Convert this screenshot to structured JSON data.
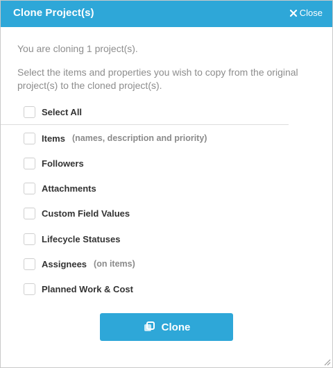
{
  "dialog": {
    "title": "Clone Project(s)",
    "close_label": "Close",
    "accent_color": "#2ea7d8"
  },
  "info": {
    "line1": "You are cloning 1 project(s).",
    "line2": "Select the items and properties you wish to copy from the original project(s) to the cloned project(s)."
  },
  "options": {
    "select_all": {
      "label": "Select All",
      "checked": false
    },
    "items": [
      {
        "label": "Items",
        "note": "(names, description and priority)",
        "checked": false
      },
      {
        "label": "Followers",
        "note": "",
        "checked": false
      },
      {
        "label": "Attachments",
        "note": "",
        "checked": false
      },
      {
        "label": "Custom Field Values",
        "note": "",
        "checked": false
      },
      {
        "label": "Lifecycle Statuses",
        "note": "",
        "checked": false
      },
      {
        "label": "Assignees",
        "note": "(on items)",
        "checked": false
      },
      {
        "label": "Planned Work & Cost",
        "note": "",
        "checked": false
      }
    ]
  },
  "actions": {
    "clone_label": "Clone",
    "clone_icon": "copy-icon"
  }
}
